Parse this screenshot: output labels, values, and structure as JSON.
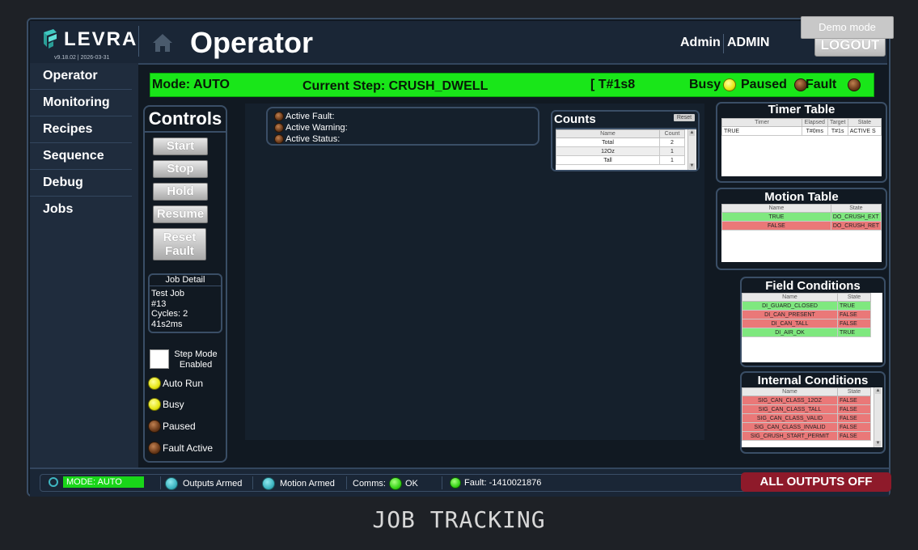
{
  "header": {
    "logo_text": "LEVRA",
    "version": "v9.18.02 | 2026-03-31",
    "title": "Operator",
    "user_role": "Admin",
    "user_name": "ADMIN",
    "logout_label": "LOGOUT",
    "demo_mode_label": "Demo mode"
  },
  "sidebar": {
    "items": [
      {
        "label": "Operator"
      },
      {
        "label": "Monitoring"
      },
      {
        "label": "Recipes"
      },
      {
        "label": "Sequence"
      },
      {
        "label": "Debug"
      },
      {
        "label": "Jobs"
      }
    ]
  },
  "status_bar": {
    "mode": "Mode: AUTO",
    "current_step": "Current Step: CRUSH_DWELL",
    "timer": "[ T#1s8",
    "busy_label": "Busy",
    "paused_label": "Paused",
    "fault_label": "Fault"
  },
  "controls": {
    "title": "Controls",
    "start": "Start",
    "stop": "Stop",
    "hold": "Hold",
    "resume": "Resume",
    "reset_fault_1": "Reset",
    "reset_fault_2": "Fault",
    "job_detail_title": "Job Detail",
    "job_line1": "Test  Job",
    "job_line2": "#13",
    "job_line3": "Cycles: 2",
    "job_line4": "41s2ms",
    "step_mode_1": "Step Mode",
    "step_mode_2": "Enabled",
    "auto_run": "Auto Run",
    "busy": "Busy",
    "paused": "Paused",
    "fault_active": "Fault Active"
  },
  "faults": {
    "active_fault": "Active Fault:",
    "active_warning": "Active Warning:",
    "active_status": "Active Status:"
  },
  "counts": {
    "title": "Counts",
    "reset": "Reset",
    "col_name": "Name",
    "col_count": "Count",
    "rows": [
      {
        "name": "Total",
        "count": "2"
      },
      {
        "name": "12Oz",
        "count": "1"
      },
      {
        "name": "Tall",
        "count": "1"
      }
    ]
  },
  "timer_table": {
    "title": "Timer Table",
    "cols": [
      "Timer",
      "Elapsed",
      "Target",
      "State"
    ],
    "rows": [
      {
        "timer": "TRUE",
        "elapsed": "T#0ms",
        "target": "T#1s",
        "state": "ACTIVE S"
      }
    ]
  },
  "motion_table": {
    "title": "Motion Table",
    "cols": [
      "Name",
      "State"
    ],
    "rows": [
      {
        "name": "TRUE",
        "state": "DO_CRUSH_EXT"
      },
      {
        "name": "FALSE",
        "state": "DO_CRUSH_RET"
      }
    ]
  },
  "field_conditions": {
    "title": "Field Conditions",
    "cols": [
      "Name",
      "State"
    ],
    "rows": [
      {
        "name": "DI_GUARD_CLOSED",
        "state": "TRUE"
      },
      {
        "name": "DI_CAN_PRESENT",
        "state": "FALSE"
      },
      {
        "name": "DI_CAN_TALL",
        "state": "FALSE"
      },
      {
        "name": "DI_AIR_OK",
        "state": "TRUE"
      }
    ]
  },
  "internal_conditions": {
    "title": "Internal Conditions",
    "cols": [
      "Name",
      "State"
    ],
    "rows": [
      {
        "name": "SIG_CAN_CLASS_12OZ",
        "state": "FALSE"
      },
      {
        "name": "SIG_CAN_CLASS_TALL",
        "state": "FALSE"
      },
      {
        "name": "SIG_CAN_CLASS_VALID",
        "state": "FALSE"
      },
      {
        "name": "SIG_CAN_CLASS_INVALID",
        "state": "FALSE"
      },
      {
        "name": "SIG_CRUSH_START_PERMIT",
        "state": "FALSE"
      }
    ]
  },
  "bottom_bar": {
    "mode": "MODE: AUTO",
    "outputs_armed": "Outputs Armed",
    "motion_armed": "Motion Armed",
    "comms_label": "Comms:",
    "comms_state": "OK",
    "fault": "Fault: -1410021876",
    "all_outputs_off": "ALL OUTPUTS OFF"
  },
  "caption": "JOB TRACKING",
  "colors": {
    "status_green": "#19e619",
    "true_row": "#7fe87f",
    "false_row": "#ea7878",
    "all_off": "#8e1a2a",
    "panel_border": "#3a4e66"
  }
}
